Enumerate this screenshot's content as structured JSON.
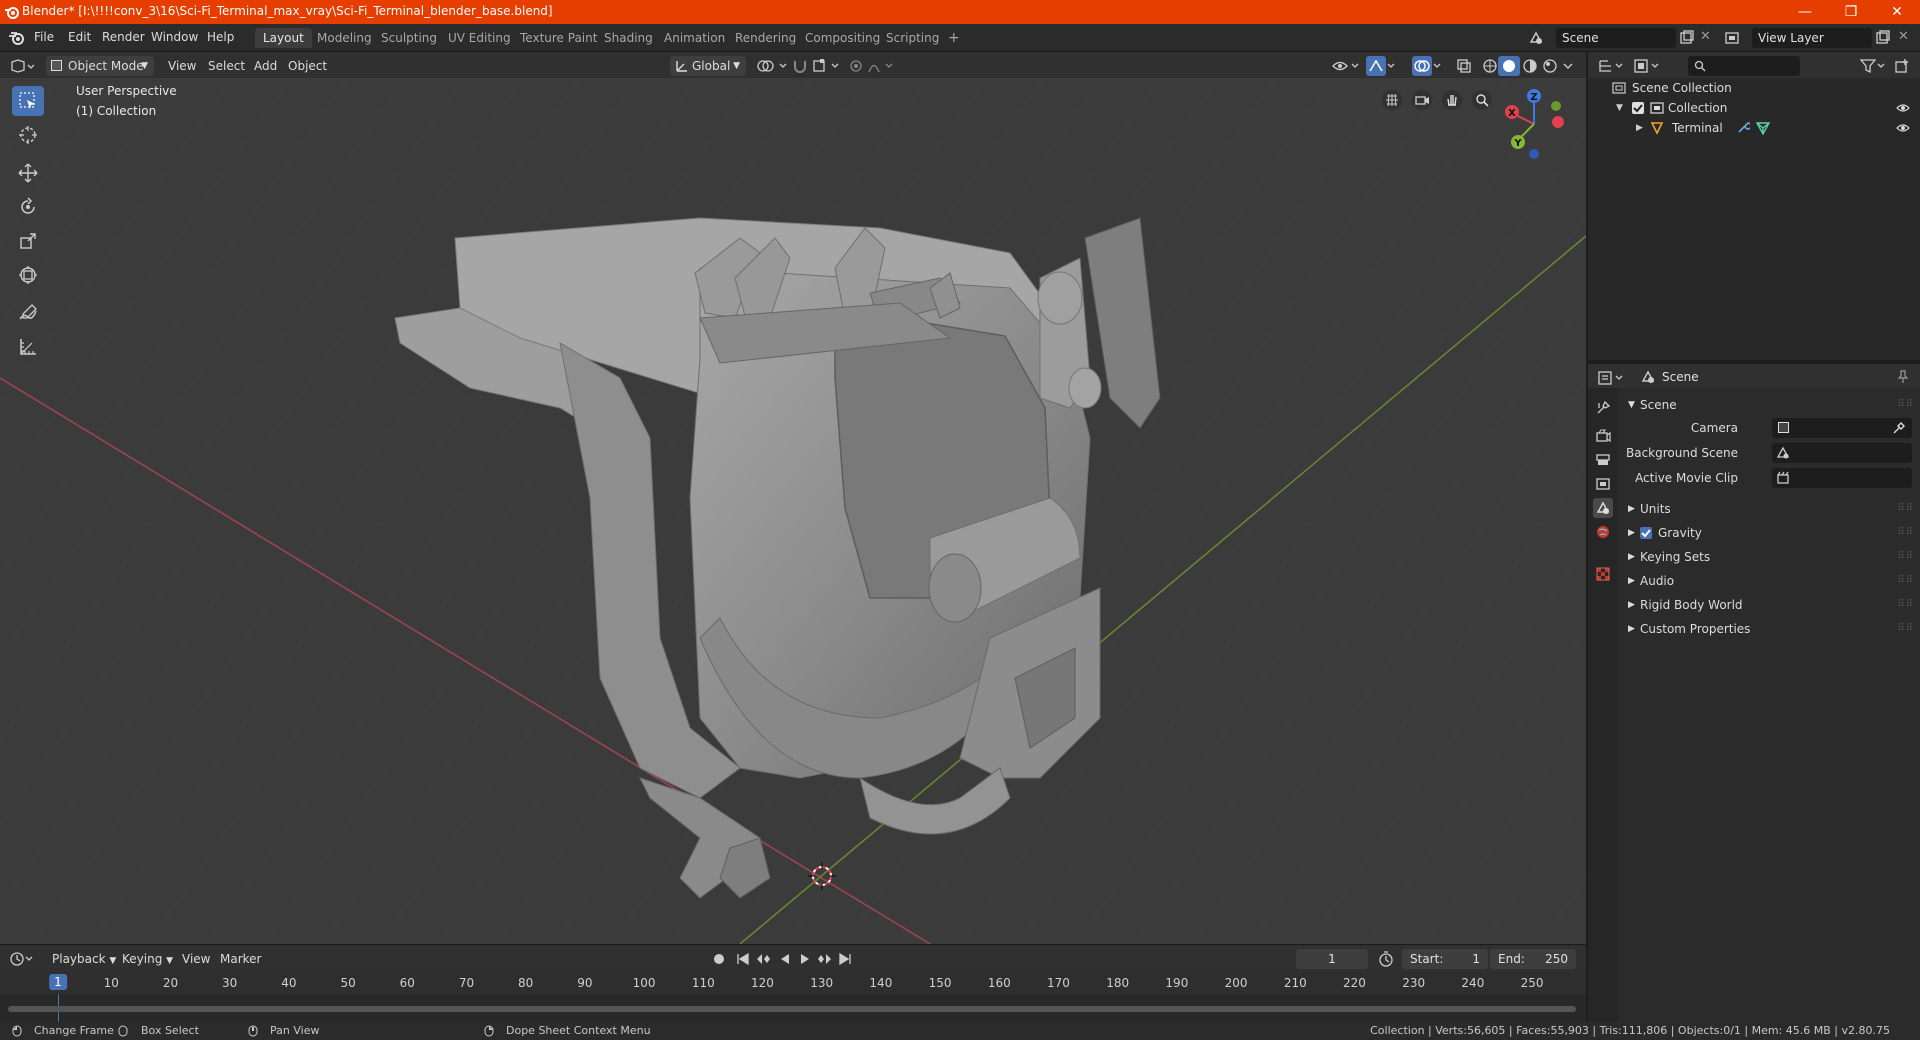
{
  "window": {
    "title": "Blender* [I:\\!!!!conv_3\\16\\Sci-Fi_Terminal_max_vray\\Sci-Fi_Terminal_blender_base.blend]",
    "minimize": "—",
    "maximize": "❐",
    "close": "✕"
  },
  "menu": {
    "items": [
      "File",
      "Edit",
      "Render",
      "Window",
      "Help"
    ],
    "workspaces": [
      "Layout",
      "Modeling",
      "Sculpting",
      "UV Editing",
      "Texture Paint",
      "Shading",
      "Animation",
      "Rendering",
      "Compositing",
      "Scripting"
    ],
    "add_workspace": "+",
    "scene_name": "Scene",
    "view_layer": "View Layer"
  },
  "viewport_header": {
    "mode": "Object Mode",
    "view": "View",
    "select": "Select",
    "add": "Add",
    "object": "Object",
    "transform_orientation": "Global"
  },
  "viewport": {
    "perspective_label": "User Perspective",
    "collection_label": "(1) Collection",
    "gizmo": {
      "x": "X",
      "y": "Y",
      "z": "Z"
    }
  },
  "timeline": {
    "playback": "Playback",
    "keying": "Keying",
    "view": "View",
    "marker": "Marker",
    "current_frame": "1",
    "start_label": "Start:",
    "start": "1",
    "end_label": "End:",
    "end": "250",
    "ruler": [
      "1",
      "10",
      "20",
      "30",
      "40",
      "50",
      "60",
      "70",
      "80",
      "90",
      "100",
      "110",
      "120",
      "130",
      "140",
      "150",
      "160",
      "170",
      "180",
      "190",
      "200",
      "210",
      "220",
      "230",
      "240",
      "250"
    ]
  },
  "status": {
    "change_frame": "Change Frame",
    "box_select": "Box Select",
    "pan_view": "Pan View",
    "context_menu": "Dope Sheet Context Menu",
    "stats": "Collection | Verts:56,605 | Faces:55,903 | Tris:111,806 | Objects:0/1 | Mem: 45.6 MB | v2.80.75"
  },
  "outliner": {
    "scene_collection": "Scene Collection",
    "collection": "Collection",
    "object": "Terminal"
  },
  "properties": {
    "header": "Scene",
    "section_scene": "Scene",
    "camera_label": "Camera",
    "background_scene_label": "Background Scene",
    "active_movie_clip_label": "Active Movie Clip",
    "units": "Units",
    "gravity": "Gravity",
    "keying_sets": "Keying Sets",
    "audio": "Audio",
    "rigid_body_world": "Rigid Body World",
    "custom_properties": "Custom Properties"
  },
  "colors": {
    "title_bar": "#e63d00",
    "accent_blue": "#4772b3",
    "axis_x": "#e04050",
    "axis_y": "#86b830",
    "axis_z": "#3e7ae0",
    "timeline_cursor": "#4772b3"
  }
}
